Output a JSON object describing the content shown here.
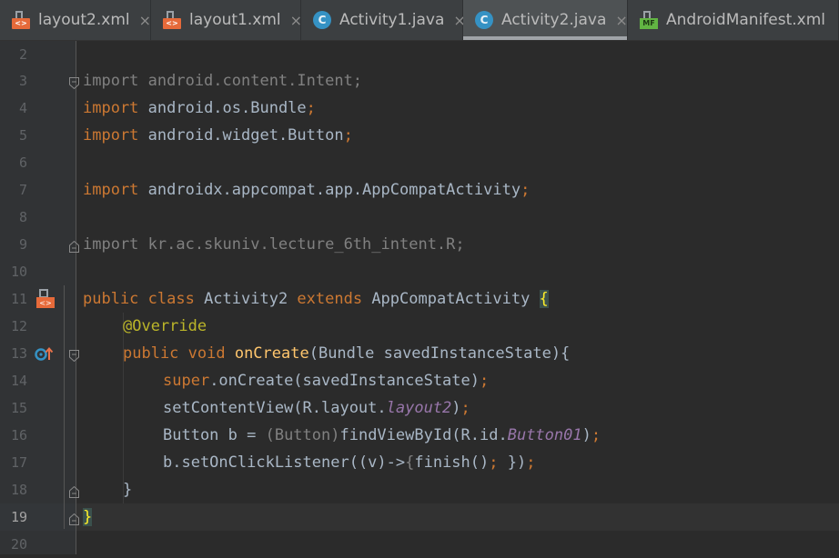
{
  "tabs": [
    {
      "label": "layout2.xml",
      "icon": "xml-layout-icon",
      "icon_text": "<>",
      "active": false
    },
    {
      "label": "layout1.xml",
      "icon": "xml-layout-icon",
      "icon_text": "<>",
      "active": false
    },
    {
      "label": "Activity1.java",
      "icon": "java-class-icon",
      "icon_text": "C",
      "active": false
    },
    {
      "label": "Activity2.java",
      "icon": "java-class-icon",
      "icon_text": "C",
      "active": true
    },
    {
      "label": "AndroidManifest.xml",
      "icon": "manifest-icon",
      "icon_text": "MF",
      "active": false
    }
  ],
  "tab_close_glyph": "×",
  "editor": {
    "line_numbers": [
      "2",
      "3",
      "4",
      "5",
      "6",
      "7",
      "8",
      "9",
      "10",
      "11",
      "12",
      "13",
      "14",
      "15",
      "16",
      "17",
      "18",
      "19",
      "20"
    ],
    "current_line": "19",
    "gutter_icons": {
      "line_11": "layout-link-icon",
      "line_13": "override-method-icon"
    },
    "code": {
      "l3": "import android.content.Intent;",
      "l4a": "import",
      "l4b": " android.os.Bundle",
      "l4c": ";",
      "l5a": "import",
      "l5b": " android.widget.Button",
      "l5c": ";",
      "l7a": "import",
      "l7b": " androidx.appcompat.app.AppCompatActivity",
      "l7c": ";",
      "l9": "import kr.ac.skuniv.lecture_6th_intent.R;",
      "l11a": "public class",
      "l11b": " Activity2 ",
      "l11c": "extends",
      "l11d": " AppCompatActivity ",
      "l11e": "{",
      "l12": "@Override",
      "l13a": "public void",
      "l13b": " onCreate",
      "l13c": "(Bundle savedInstanceState){",
      "l14a": "super",
      "l14b": ".onCreate(savedInstanceState)",
      "l14c": ";",
      "l15a": "setContentView(R.layout.",
      "l15b": "layout2",
      "l15c": ")",
      "l15d": ";",
      "l16a": "Button b = ",
      "l16b": "(Button)",
      "l16c": "findViewById(R.id.",
      "l16d": "Button01",
      "l16e": ")",
      "l16f": ";",
      "l17a": "b.setOnClickListener((v)->",
      "l17b": "{",
      "l17c": "finish()",
      "l17d": ";",
      "l17e": " })",
      "l17f": ";",
      "l18": "}",
      "l19": "}"
    }
  },
  "colors": {
    "background": "#2b2b2b",
    "keyword": "#cc7832",
    "identifier": "#a9b7c6",
    "annotation": "#bbb529",
    "method_decl": "#ffc66d",
    "static_field": "#9876aa",
    "unused_import": "#808080"
  }
}
